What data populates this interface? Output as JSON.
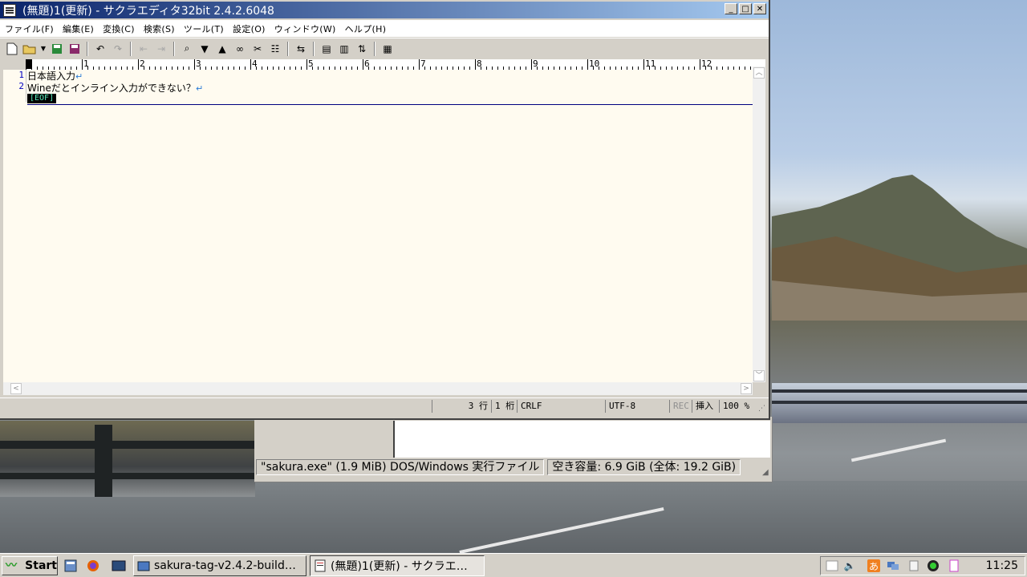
{
  "window": {
    "title": "(無題)1(更新) - サクラエディタ32bit 2.4.2.6048",
    "controls": {
      "minimize": "_",
      "maximize": "□",
      "close": "✕"
    }
  },
  "menu": [
    "ファイル(F)",
    "編集(E)",
    "変換(C)",
    "検索(S)",
    "ツール(T)",
    "設定(O)",
    "ウィンドウ(W)",
    "ヘルプ(H)"
  ],
  "ruler": {
    "marks": [
      "1",
      "2",
      "3",
      "4",
      "5",
      "6",
      "7",
      "8",
      "9",
      "10",
      "11",
      "12"
    ]
  },
  "editor": {
    "lines": [
      {
        "no": "1",
        "text": "日本語入力"
      },
      {
        "no": "2",
        "text": "Wineだとインライン入力ができない？"
      }
    ],
    "eol_mark": "↵",
    "eof_marker": "[EOF]"
  },
  "status": {
    "line": "3 行",
    "col": "1 桁",
    "eol": "CRLF",
    "encoding": "UTF-8",
    "rec": "REC",
    "mode": "挿入",
    "zoom": "100 %"
  },
  "file_manager": {
    "file_info": "\"sakura.exe\" (1.9 MiB) DOS/Windows 実行ファイル",
    "disk_info": "空き容量: 6.9 GiB (全体: 19.2 GiB)"
  },
  "taskbar": {
    "start_label": "Start",
    "tasks": [
      {
        "label": "sakura-tag-v2.4.2-build…"
      },
      {
        "label": "(無題)1(更新) - サクラエ…"
      }
    ],
    "clock": "11:25",
    "ime_indicator": "あ"
  }
}
